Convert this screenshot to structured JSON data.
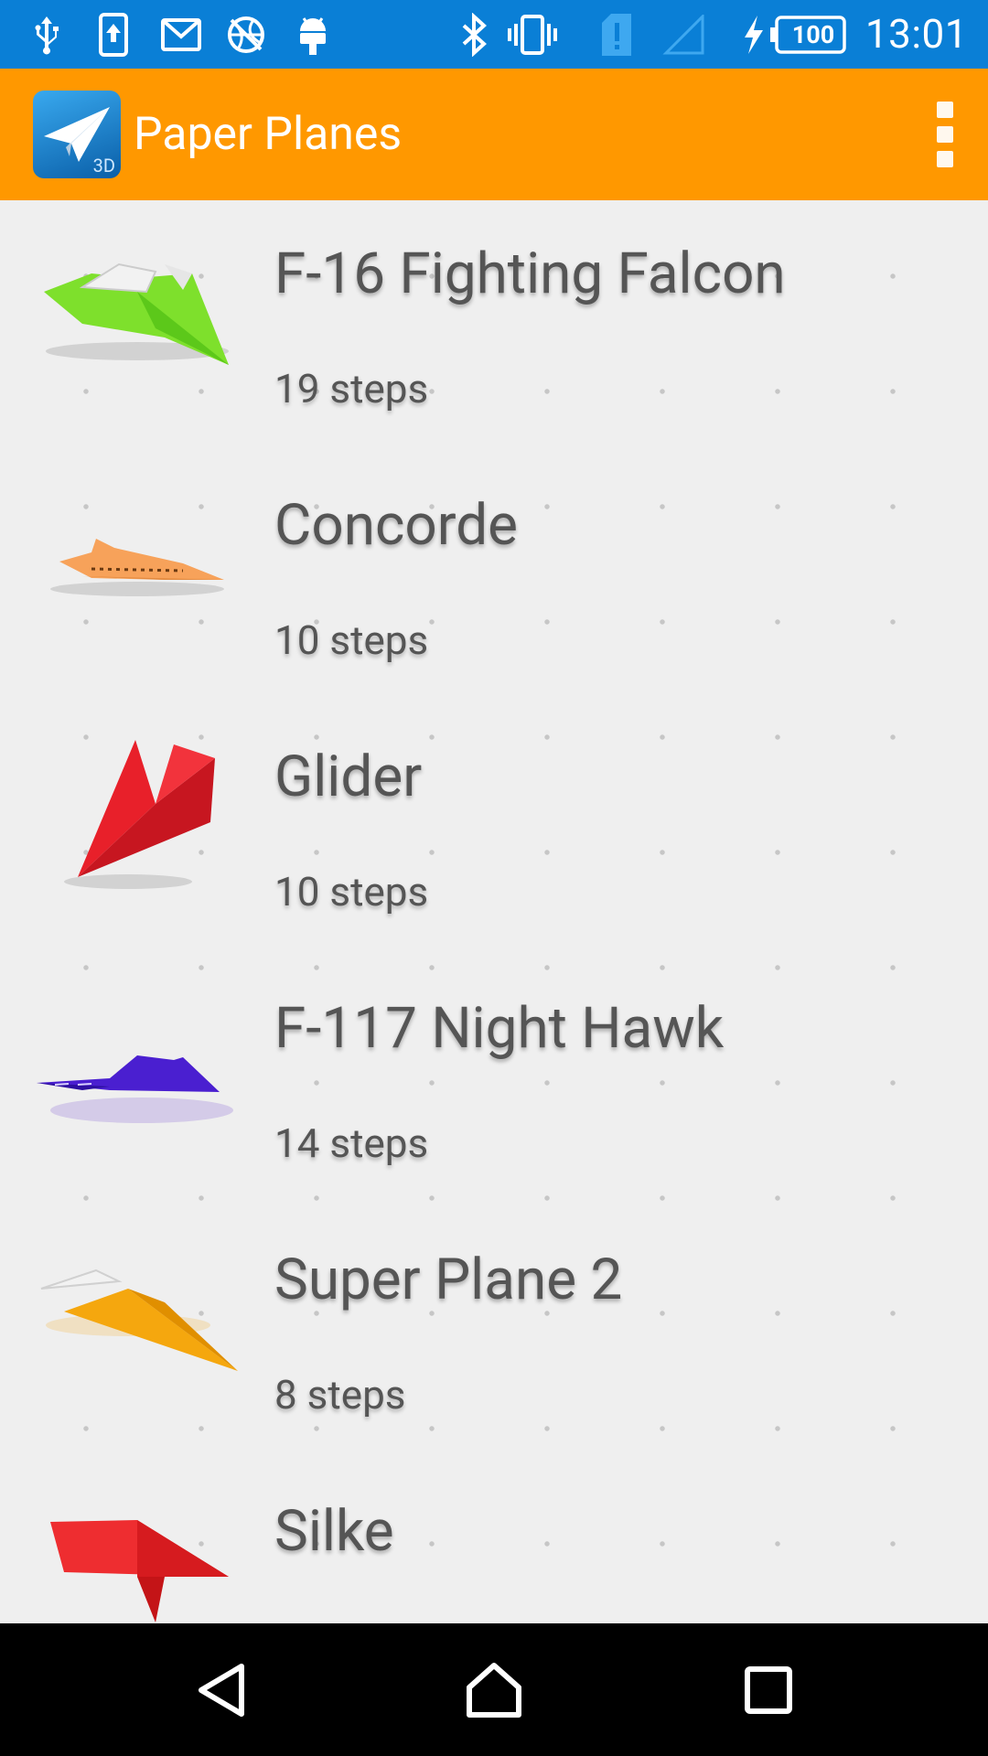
{
  "status_bar": {
    "time": "13:01",
    "battery_level": "100",
    "icons": [
      "usb-icon",
      "upload-icon",
      "gmail-icon",
      "vpn-globe-icon",
      "android-debug-icon",
      "bluetooth-icon",
      "vibrate-icon",
      "sim-alert-icon",
      "no-signal-icon",
      "charging-icon",
      "battery-icon"
    ]
  },
  "app_bar": {
    "title": "Paper Planes",
    "logo_badge": "3D",
    "accent_color": "#ff9800"
  },
  "planes": [
    {
      "name": "F-16 Fighting Falcon",
      "steps": "19 steps",
      "color": "#7ee02c",
      "icon": "f16-plane-icon"
    },
    {
      "name": "Concorde",
      "steps": "10 steps",
      "color": "#f7a25a",
      "icon": "concorde-plane-icon"
    },
    {
      "name": "Glider",
      "steps": "10 steps",
      "color": "#e8202a",
      "icon": "glider-plane-icon"
    },
    {
      "name": "F-117 Night Hawk",
      "steps": "14 steps",
      "color": "#4a1fd0",
      "icon": "nighthawk-plane-icon"
    },
    {
      "name": "Super Plane 2",
      "steps": "8 steps",
      "color": "#f5a70e",
      "icon": "superplane-plane-icon"
    },
    {
      "name": "Silke",
      "steps": "",
      "color": "#ee2d30",
      "icon": "silke-plane-icon"
    }
  ],
  "nav_bar": {
    "buttons": [
      "back",
      "home",
      "recents"
    ]
  }
}
